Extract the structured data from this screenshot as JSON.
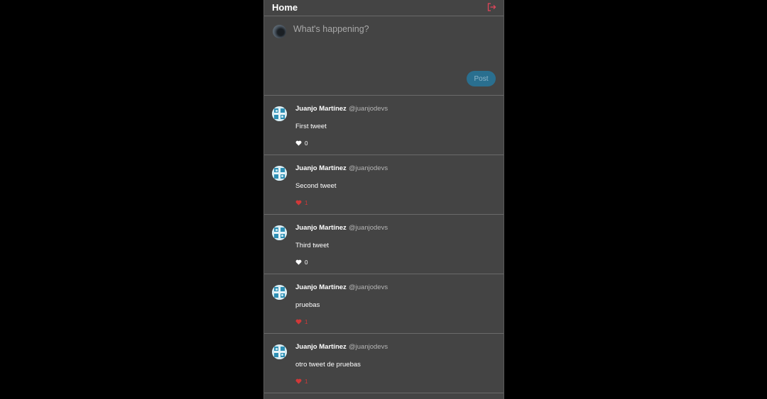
{
  "header": {
    "title": "Home",
    "logout_icon": "logout-icon",
    "logout_color": "#e0455a"
  },
  "composer": {
    "placeholder": "What's happening?",
    "value": "",
    "post_label": "Post"
  },
  "colors": {
    "background": "#000000",
    "panel": "#444444",
    "liked": "#d13838",
    "post_button": "#2a6f8f"
  },
  "tweets": [
    {
      "name": "Juanjo Martínez",
      "handle": "@juanjodevs",
      "text": "First tweet",
      "likes": "0",
      "liked": false
    },
    {
      "name": "Juanjo Martínez",
      "handle": "@juanjodevs",
      "text": "Second tweet",
      "likes": "1",
      "liked": true
    },
    {
      "name": "Juanjo Martínez",
      "handle": "@juanjodevs",
      "text": "Third tweet",
      "likes": "0",
      "liked": false
    },
    {
      "name": "Juanjo Martínez",
      "handle": "@juanjodevs",
      "text": "pruebas",
      "likes": "1",
      "liked": true
    },
    {
      "name": "Juanjo Martínez",
      "handle": "@juanjodevs",
      "text": "otro tweet de pruebas",
      "likes": "1",
      "liked": true
    }
  ]
}
